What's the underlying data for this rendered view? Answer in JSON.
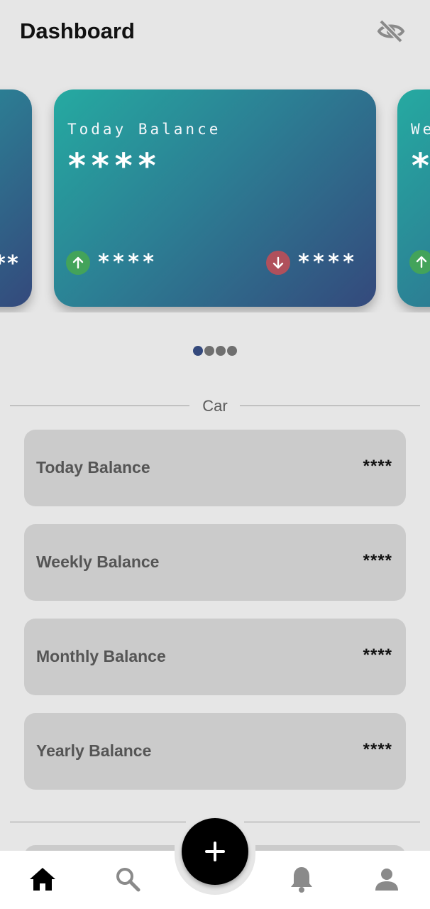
{
  "header": {
    "title": "Dashboard",
    "visibility_icon": "eye-off-icon"
  },
  "cards": [
    {
      "label": "",
      "amount": "****",
      "income": "",
      "expense": "****"
    },
    {
      "label": "Today Balance",
      "amount": "****",
      "income": "****",
      "expense": "****"
    },
    {
      "label": "We",
      "amount": "*",
      "income": "",
      "expense": ""
    }
  ],
  "carousel_dots": {
    "count": 4,
    "active_index": 0
  },
  "sections": [
    {
      "title": "Car",
      "rows": [
        {
          "label": "Today Balance",
          "value": "****"
        },
        {
          "label": "Weekly Balance",
          "value": "****"
        },
        {
          "label": "Monthly Balance",
          "value": "****"
        },
        {
          "label": "Yearly Balance",
          "value": "****"
        }
      ]
    }
  ],
  "bottom_nav": {
    "items": [
      "home-icon",
      "search-icon",
      "add-icon",
      "bell-icon",
      "profile-icon"
    ],
    "active": "home-icon"
  },
  "colors": {
    "background": "#e6e6e6",
    "card_gradient_start": "#25aaa1",
    "card_gradient_end": "#34497c",
    "income_green": "#43a35a",
    "expense_red": "#b0505c",
    "row_bg": "#cbcbcb"
  }
}
